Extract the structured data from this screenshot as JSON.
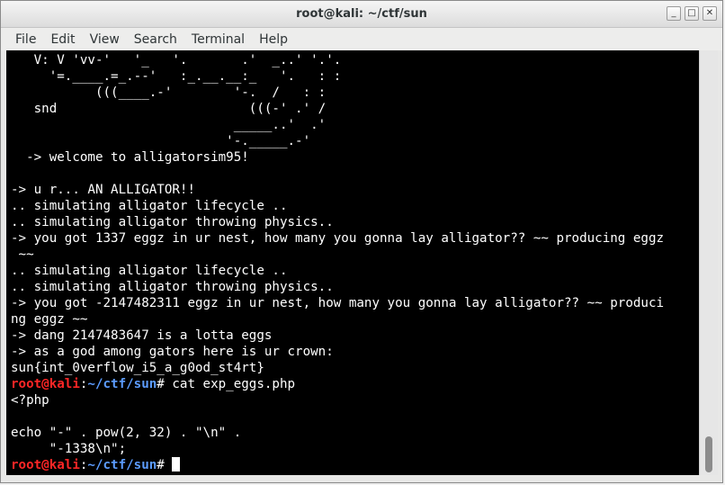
{
  "window": {
    "title": "root@kali: ~/ctf/sun",
    "minimize": "_",
    "maximize": "□",
    "close": "✕"
  },
  "menu": [
    "File",
    "Edit",
    "View",
    "Search",
    "Terminal",
    "Help"
  ],
  "terminal": {
    "lines": [
      "   V: V 'vv-'   '_   '.       .'  _..' '.'.",
      "     '=.____.=_.--'   :_.__.__:_   '.   : :",
      "           (((____.-'        '-.  /   : :",
      "   snd                         (((-' .' /",
      "                             _____..'  .'",
      "                            '-._____.-'",
      "  -> welcome to alligatorsim95!",
      "",
      "-> u r... AN ALLIGATOR!!",
      ".. simulating alligator lifecycle ..",
      ".. simulating alligator throwing physics..",
      "-> you got 1337 eggz in ur nest, how many you gonna lay alligator?? ~~ producing eggz",
      " ~~",
      ".. simulating alligator lifecycle ..",
      ".. simulating alligator throwing physics..",
      "-> you got -2147482311 eggz in ur nest, how many you gonna lay alligator?? ~~ produci",
      "ng eggz ~~",
      "-> dang 2147483647 is a lotta eggs",
      "-> as a god among gators here is ur crown:",
      "sun{int_0verflow_i5_a_g0od_st4rt}"
    ],
    "prompt1": {
      "user": "root@kali",
      "sep": ":",
      "path": "~/ctf/sun",
      "hash": "# ",
      "command": "cat exp_eggs.php"
    },
    "after": [
      "<?php",
      "",
      "echo \"-\" . pow(2, 32) . \"\\n\" .",
      "     \"-1338\\n\";"
    ],
    "prompt2": {
      "user": "root@kali",
      "sep": ":",
      "path": "~/ctf/sun",
      "hash": "# "
    }
  },
  "colors": {
    "prompt_user": "#ff2626",
    "prompt_path": "#5c9cff",
    "background": "#000000",
    "text": "#ffffff"
  }
}
